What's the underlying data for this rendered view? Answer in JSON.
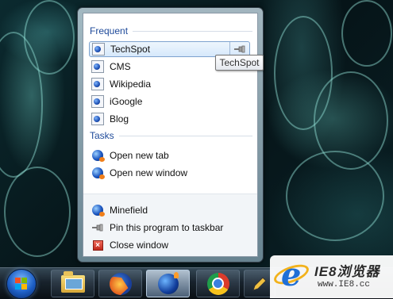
{
  "jumplist": {
    "frequent_header": "Frequent",
    "frequent_items": [
      {
        "label": "TechSpot"
      },
      {
        "label": "CMS"
      },
      {
        "label": "Wikipedia"
      },
      {
        "label": "iGoogle"
      },
      {
        "label": "Blog"
      }
    ],
    "tasks_header": "Tasks",
    "task_items": [
      {
        "label": "Open new tab"
      },
      {
        "label": "Open new window"
      }
    ],
    "footer_items": [
      {
        "label": "Minefield",
        "icon": "minefield-icon"
      },
      {
        "label": "Pin this program to taskbar",
        "icon": "pin-icon"
      },
      {
        "label": "Close window",
        "icon": "close-icon"
      }
    ]
  },
  "tooltip": {
    "text": "TechSpot"
  },
  "taskbar": {
    "items": [
      {
        "icon": "start-orb-icon"
      },
      {
        "icon": "folder-icon"
      },
      {
        "icon": "firefox-icon"
      },
      {
        "icon": "minefield-icon",
        "active": true
      },
      {
        "icon": "chrome-icon"
      },
      {
        "icon": "pen-icon"
      }
    ]
  },
  "watermark": {
    "title": "IE8浏览器",
    "url": "www.IE8.cc"
  },
  "colors": {
    "section_header": "#1e4a9a",
    "hover_border": "#7da2ce",
    "taskbar_dark": "#0a0f14"
  }
}
